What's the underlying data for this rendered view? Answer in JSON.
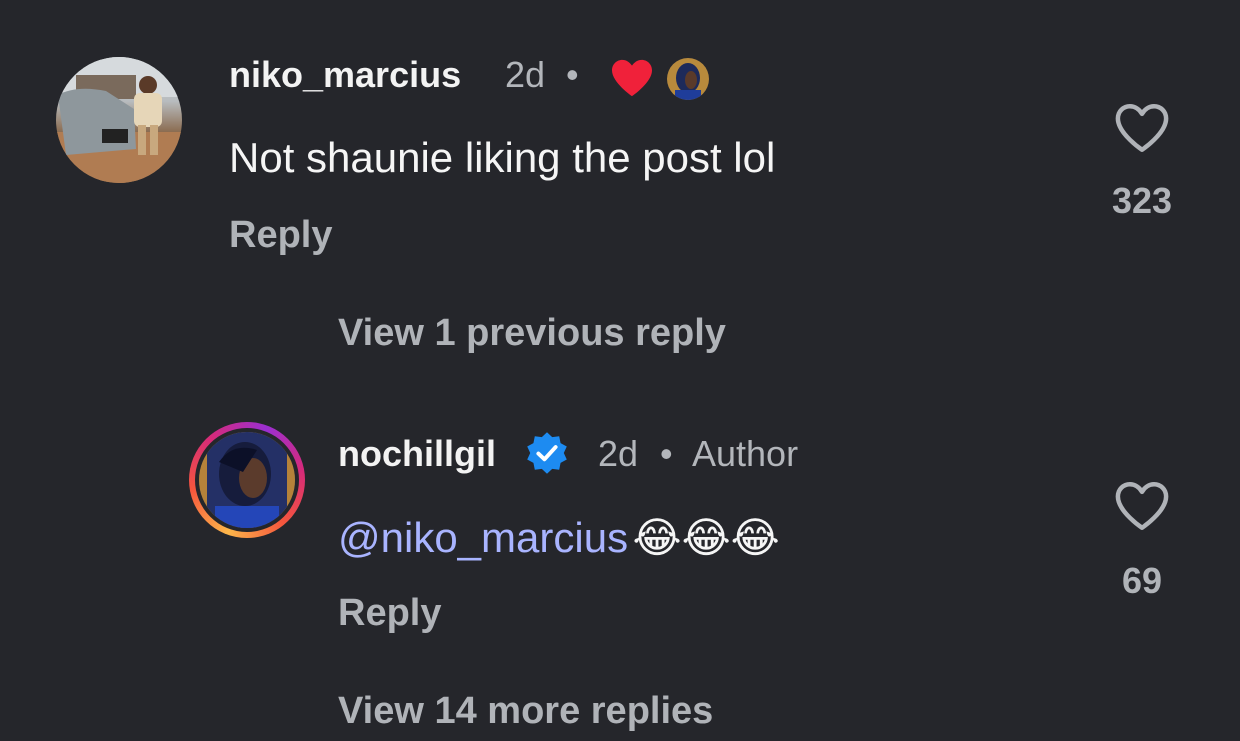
{
  "comments": [
    {
      "username": "niko_marcius",
      "time": "2d",
      "separator": "•",
      "text": "Not shaunie liking the post lol",
      "reply_label": "Reply",
      "likes": "323",
      "author_liked_icon": "heart-icon"
    },
    {
      "username": "nochillgil",
      "verified_icon": "verified-badge-icon",
      "time": "2d",
      "separator": "•",
      "tag": "Author",
      "mention": "@niko_marcius",
      "emojis": "😂😂😂",
      "reply_label": "Reply",
      "likes": "69"
    }
  ],
  "view_previous_label": "View 1 previous reply",
  "view_more_label": "View 14 more replies",
  "colors": {
    "background": "#25262b",
    "mention": "#a9b4ff",
    "verified": "#1d8bf1",
    "liked_heart": "#f0213a"
  }
}
